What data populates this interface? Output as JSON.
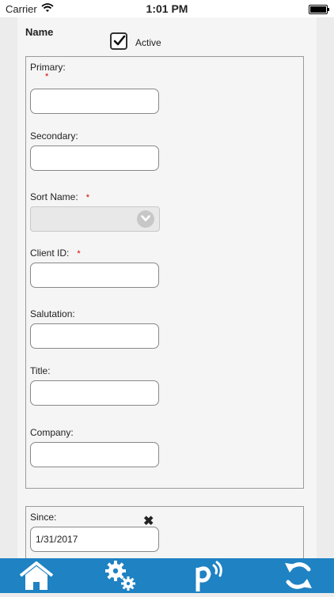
{
  "status_bar": {
    "carrier": "Carrier",
    "time": "1:01 PM"
  },
  "form": {
    "section_title": "Name",
    "active": {
      "label": "Active",
      "checked": true
    },
    "fields": {
      "primary": {
        "label": "Primary:",
        "required_mark": "*",
        "value": ""
      },
      "secondary": {
        "label": "Secondary:",
        "value": ""
      },
      "sort_name": {
        "label": "Sort Name:",
        "required_mark": "*",
        "value": ""
      },
      "client_id": {
        "label": "Client ID:",
        "required_mark": "*",
        "value": ""
      },
      "salutation": {
        "label": "Salutation:",
        "value": ""
      },
      "title": {
        "label": "Title:",
        "value": ""
      },
      "company": {
        "label": "Company:",
        "value": ""
      },
      "since": {
        "label": "Since:",
        "value": "1/31/2017",
        "clear_icon": "✖"
      }
    }
  },
  "tab_bar": {
    "background": "#1e82c3",
    "tabs": [
      {
        "icon": "home-icon"
      },
      {
        "icon": "gears-icon"
      },
      {
        "icon": "p-signal-icon"
      },
      {
        "icon": "sync-icon"
      }
    ]
  }
}
